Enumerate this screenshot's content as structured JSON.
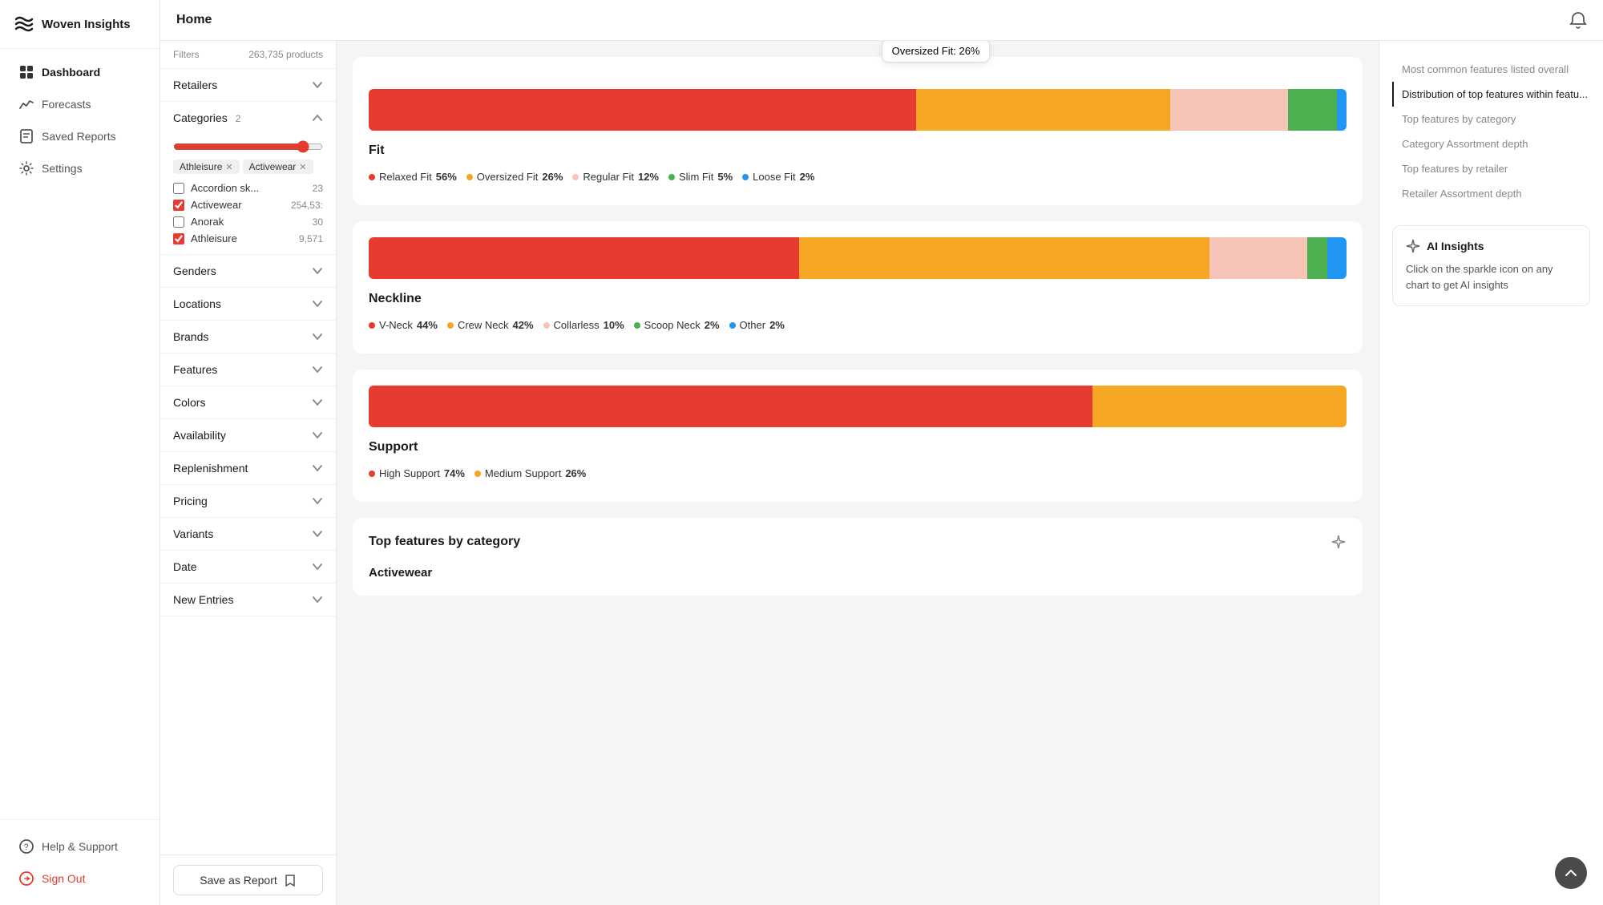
{
  "app": {
    "name": "Woven Insights"
  },
  "sidebar": {
    "nav_items": [
      {
        "id": "dashboard",
        "label": "Dashboard",
        "active": true
      },
      {
        "id": "forecasts",
        "label": "Forecasts",
        "active": false
      },
      {
        "id": "saved-reports",
        "label": "Saved Reports",
        "active": false
      },
      {
        "id": "settings",
        "label": "Settings",
        "active": false
      }
    ],
    "bottom_items": [
      {
        "id": "help",
        "label": "Help & Support"
      },
      {
        "id": "signout",
        "label": "Sign Out"
      }
    ]
  },
  "header": {
    "title": "Home"
  },
  "filters": {
    "label": "Filters",
    "count": "263,735 products",
    "sections": [
      {
        "id": "retailers",
        "label": "Retailers",
        "expanded": false
      },
      {
        "id": "categories",
        "label": "Categories",
        "count": 2,
        "expanded": true
      },
      {
        "id": "genders",
        "label": "Genders",
        "expanded": false
      },
      {
        "id": "locations",
        "label": "Locations",
        "expanded": false
      },
      {
        "id": "brands",
        "label": "Brands",
        "expanded": false
      },
      {
        "id": "features",
        "label": "Features",
        "expanded": false
      },
      {
        "id": "colors",
        "label": "Colors",
        "expanded": false
      },
      {
        "id": "availability",
        "label": "Availability",
        "expanded": false
      },
      {
        "id": "replenishment",
        "label": "Replenishment",
        "expanded": false
      },
      {
        "id": "pricing",
        "label": "Pricing",
        "expanded": false
      },
      {
        "id": "variants",
        "label": "Variants",
        "expanded": false
      },
      {
        "id": "date",
        "label": "Date",
        "expanded": false
      },
      {
        "id": "new-entries",
        "label": "New Entries",
        "expanded": false
      }
    ],
    "categories": {
      "tags": [
        "Athleisure",
        "Activewear"
      ],
      "items": [
        {
          "id": "accordion-sk",
          "label": "Accordion sk...",
          "count": "23",
          "checked": false
        },
        {
          "id": "activewear",
          "label": "Activewear",
          "count": "254,53:",
          "checked": true
        },
        {
          "id": "anorak",
          "label": "Anorak",
          "count": "30",
          "checked": false
        },
        {
          "id": "athleisure",
          "label": "Athleisure",
          "count": "9,571",
          "checked": true
        }
      ]
    },
    "save_report_label": "Save as Report"
  },
  "main": {
    "charts": [
      {
        "id": "fit",
        "title": "Fit",
        "tooltip": "Oversized Fit: 26%",
        "segments": [
          {
            "label": "Relaxed Fit",
            "pct": 56,
            "color": "#e63b2e"
          },
          {
            "label": "Oversized Fit",
            "pct": 26,
            "color": "#f5a623"
          },
          {
            "label": "Regular Fit",
            "pct": 12,
            "color": "#f7c4b8"
          },
          {
            "label": "Slim Fit",
            "pct": 5,
            "color": "#4caf50"
          },
          {
            "label": "Loose Fit",
            "pct": 2,
            "color": "#2196f3"
          }
        ],
        "legend": [
          {
            "label": "Relaxed Fit",
            "value": "56%",
            "color": "#e63b2e"
          },
          {
            "label": "Oversized Fit",
            "value": "26%",
            "color": "#f5a623"
          },
          {
            "label": "Regular Fit",
            "value": "12%",
            "color": "#f7c4b8"
          },
          {
            "label": "Slim Fit",
            "value": "5%",
            "color": "#4caf50"
          },
          {
            "label": "Loose Fit",
            "value": "2%",
            "color": "#2196f3"
          }
        ]
      },
      {
        "id": "neckline",
        "title": "Neckline",
        "segments": [
          {
            "label": "V-Neck",
            "pct": 44,
            "color": "#e63b2e"
          },
          {
            "label": "Crew Neck",
            "pct": 42,
            "color": "#f5a623"
          },
          {
            "label": "Collarless",
            "pct": 10,
            "color": "#f7c4b8"
          },
          {
            "label": "Scoop Neck",
            "pct": 2,
            "color": "#4caf50"
          },
          {
            "label": "Other",
            "pct": 2,
            "color": "#2196f3"
          }
        ],
        "legend": [
          {
            "label": "V-Neck",
            "value": "44%",
            "color": "#e63b2e"
          },
          {
            "label": "Crew Neck",
            "value": "42%",
            "color": "#f5a623"
          },
          {
            "label": "Collarless",
            "value": "10%",
            "color": "#f7c4b8"
          },
          {
            "label": "Scoop Neck",
            "value": "2%",
            "color": "#4caf50"
          },
          {
            "label": "Other",
            "value": "2%",
            "color": "#2196f3"
          }
        ]
      },
      {
        "id": "support",
        "title": "Support",
        "segments": [
          {
            "label": "High Support",
            "pct": 74,
            "color": "#e63b2e"
          },
          {
            "label": "Medium Support",
            "pct": 26,
            "color": "#f5a623"
          }
        ],
        "legend": [
          {
            "label": "High Support",
            "value": "74%",
            "color": "#e63b2e"
          },
          {
            "label": "Medium Support",
            "value": "26%",
            "color": "#f5a623"
          }
        ]
      }
    ],
    "top_features_card": {
      "title": "Top features by category",
      "category_label": "Activewear"
    }
  },
  "right_panel": {
    "nav_items": [
      {
        "id": "most-common",
        "label": "Most common features listed overall",
        "active": false
      },
      {
        "id": "distribution",
        "label": "Distribution of top features within featu...",
        "active": true
      },
      {
        "id": "top-by-cat",
        "label": "Top features by category",
        "active": false
      },
      {
        "id": "cat-assortment",
        "label": "Category Assortment depth",
        "active": false
      },
      {
        "id": "top-by-retailer",
        "label": "Top features by retailer",
        "active": false
      },
      {
        "id": "retailer-assortment",
        "label": "Retailer Assortment depth",
        "active": false
      }
    ],
    "ai_insights": {
      "title": "AI Insights",
      "text": "Click on the sparkle icon on any chart to get AI insights"
    }
  }
}
